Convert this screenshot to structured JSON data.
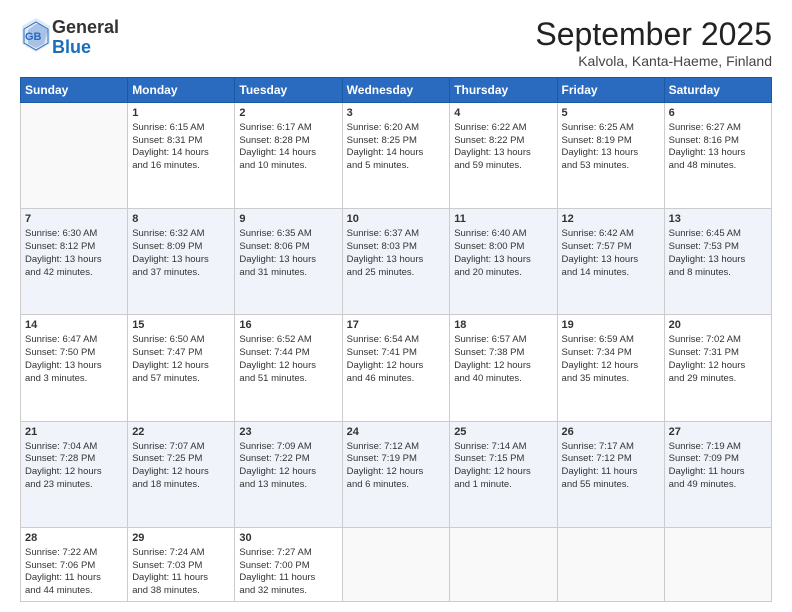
{
  "header": {
    "logo_general": "General",
    "logo_blue": "Blue",
    "month_title": "September 2025",
    "location": "Kalvola, Kanta-Haeme, Finland"
  },
  "days_of_week": [
    "Sunday",
    "Monday",
    "Tuesday",
    "Wednesday",
    "Thursday",
    "Friday",
    "Saturday"
  ],
  "weeks": [
    [
      {
        "day": "",
        "content": ""
      },
      {
        "day": "1",
        "content": "Sunrise: 6:15 AM\nSunset: 8:31 PM\nDaylight: 14 hours\nand 16 minutes."
      },
      {
        "day": "2",
        "content": "Sunrise: 6:17 AM\nSunset: 8:28 PM\nDaylight: 14 hours\nand 10 minutes."
      },
      {
        "day": "3",
        "content": "Sunrise: 6:20 AM\nSunset: 8:25 PM\nDaylight: 14 hours\nand 5 minutes."
      },
      {
        "day": "4",
        "content": "Sunrise: 6:22 AM\nSunset: 8:22 PM\nDaylight: 13 hours\nand 59 minutes."
      },
      {
        "day": "5",
        "content": "Sunrise: 6:25 AM\nSunset: 8:19 PM\nDaylight: 13 hours\nand 53 minutes."
      },
      {
        "day": "6",
        "content": "Sunrise: 6:27 AM\nSunset: 8:16 PM\nDaylight: 13 hours\nand 48 minutes."
      }
    ],
    [
      {
        "day": "7",
        "content": "Sunrise: 6:30 AM\nSunset: 8:12 PM\nDaylight: 13 hours\nand 42 minutes."
      },
      {
        "day": "8",
        "content": "Sunrise: 6:32 AM\nSunset: 8:09 PM\nDaylight: 13 hours\nand 37 minutes."
      },
      {
        "day": "9",
        "content": "Sunrise: 6:35 AM\nSunset: 8:06 PM\nDaylight: 13 hours\nand 31 minutes."
      },
      {
        "day": "10",
        "content": "Sunrise: 6:37 AM\nSunset: 8:03 PM\nDaylight: 13 hours\nand 25 minutes."
      },
      {
        "day": "11",
        "content": "Sunrise: 6:40 AM\nSunset: 8:00 PM\nDaylight: 13 hours\nand 20 minutes."
      },
      {
        "day": "12",
        "content": "Sunrise: 6:42 AM\nSunset: 7:57 PM\nDaylight: 13 hours\nand 14 minutes."
      },
      {
        "day": "13",
        "content": "Sunrise: 6:45 AM\nSunset: 7:53 PM\nDaylight: 13 hours\nand 8 minutes."
      }
    ],
    [
      {
        "day": "14",
        "content": "Sunrise: 6:47 AM\nSunset: 7:50 PM\nDaylight: 13 hours\nand 3 minutes."
      },
      {
        "day": "15",
        "content": "Sunrise: 6:50 AM\nSunset: 7:47 PM\nDaylight: 12 hours\nand 57 minutes."
      },
      {
        "day": "16",
        "content": "Sunrise: 6:52 AM\nSunset: 7:44 PM\nDaylight: 12 hours\nand 51 minutes."
      },
      {
        "day": "17",
        "content": "Sunrise: 6:54 AM\nSunset: 7:41 PM\nDaylight: 12 hours\nand 46 minutes."
      },
      {
        "day": "18",
        "content": "Sunrise: 6:57 AM\nSunset: 7:38 PM\nDaylight: 12 hours\nand 40 minutes."
      },
      {
        "day": "19",
        "content": "Sunrise: 6:59 AM\nSunset: 7:34 PM\nDaylight: 12 hours\nand 35 minutes."
      },
      {
        "day": "20",
        "content": "Sunrise: 7:02 AM\nSunset: 7:31 PM\nDaylight: 12 hours\nand 29 minutes."
      }
    ],
    [
      {
        "day": "21",
        "content": "Sunrise: 7:04 AM\nSunset: 7:28 PM\nDaylight: 12 hours\nand 23 minutes."
      },
      {
        "day": "22",
        "content": "Sunrise: 7:07 AM\nSunset: 7:25 PM\nDaylight: 12 hours\nand 18 minutes."
      },
      {
        "day": "23",
        "content": "Sunrise: 7:09 AM\nSunset: 7:22 PM\nDaylight: 12 hours\nand 13 minutes."
      },
      {
        "day": "24",
        "content": "Sunrise: 7:12 AM\nSunset: 7:19 PM\nDaylight: 12 hours\nand 6 minutes."
      },
      {
        "day": "25",
        "content": "Sunrise: 7:14 AM\nSunset: 7:15 PM\nDaylight: 12 hours\nand 1 minute."
      },
      {
        "day": "26",
        "content": "Sunrise: 7:17 AM\nSunset: 7:12 PM\nDaylight: 11 hours\nand 55 minutes."
      },
      {
        "day": "27",
        "content": "Sunrise: 7:19 AM\nSunset: 7:09 PM\nDaylight: 11 hours\nand 49 minutes."
      }
    ],
    [
      {
        "day": "28",
        "content": "Sunrise: 7:22 AM\nSunset: 7:06 PM\nDaylight: 11 hours\nand 44 minutes."
      },
      {
        "day": "29",
        "content": "Sunrise: 7:24 AM\nSunset: 7:03 PM\nDaylight: 11 hours\nand 38 minutes."
      },
      {
        "day": "30",
        "content": "Sunrise: 7:27 AM\nSunset: 7:00 PM\nDaylight: 11 hours\nand 32 minutes."
      },
      {
        "day": "",
        "content": ""
      },
      {
        "day": "",
        "content": ""
      },
      {
        "day": "",
        "content": ""
      },
      {
        "day": "",
        "content": ""
      }
    ]
  ]
}
